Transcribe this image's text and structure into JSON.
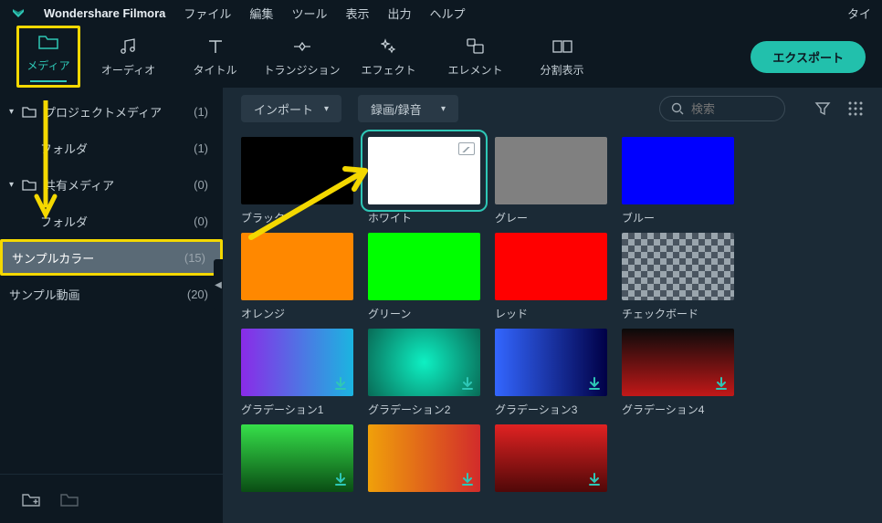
{
  "app_title": "Wondershare Filmora",
  "menu": [
    "ファイル",
    "編集",
    "ツール",
    "表示",
    "出力",
    "ヘルプ"
  ],
  "titlebar_right": "タイ",
  "tabs": [
    {
      "id": "media",
      "label": "メディア"
    },
    {
      "id": "audio",
      "label": "オーディオ"
    },
    {
      "id": "title",
      "label": "タイトル"
    },
    {
      "id": "transition",
      "label": "トランジション"
    },
    {
      "id": "effect",
      "label": "エフェクト"
    },
    {
      "id": "element",
      "label": "エレメント"
    },
    {
      "id": "split",
      "label": "分割表示"
    }
  ],
  "export_label": "エクスポート",
  "sidebar": {
    "items": [
      {
        "label": "プロジェクトメディア",
        "count": "(1)",
        "chevron": true,
        "folder": true
      },
      {
        "label": "フォルダ",
        "count": "(1)",
        "child": true
      },
      {
        "label": "共有メディア",
        "count": "(0)",
        "chevron": true,
        "folder": true
      },
      {
        "label": "フォルダ",
        "count": "(0)",
        "child": true
      },
      {
        "label": "サンプルカラー",
        "count": "(15)",
        "selected": true,
        "boxed": true
      },
      {
        "label": "サンプル動画",
        "count": "(20)"
      }
    ]
  },
  "topbar": {
    "import_label": "インポート",
    "record_label": "録画/録音",
    "search_placeholder": "検索"
  },
  "cards": [
    [
      {
        "label": "ブラック",
        "bg": "#000000"
      },
      {
        "label": "ホワイト",
        "bg": "#ffffff",
        "boxed": true,
        "selected": true,
        "placeholder": true
      },
      {
        "label": "グレー",
        "bg": "#808080"
      },
      {
        "label": "ブルー",
        "bg": "#0000ff"
      }
    ],
    [
      {
        "label": "オレンジ",
        "bg": "#ff8800"
      },
      {
        "label": "グリーン",
        "bg": "#00ff00"
      },
      {
        "label": "レッド",
        "bg": "#ff0000"
      },
      {
        "label": "チェックボード",
        "class": "checker"
      }
    ],
    [
      {
        "label": "グラデーション1",
        "class": "grad1",
        "dl": true
      },
      {
        "label": "グラデーション2",
        "class": "grad2",
        "dl": true
      },
      {
        "label": "グラデーション3",
        "class": "grad3",
        "dl": true
      },
      {
        "label": "グラデーション4",
        "class": "grad4",
        "dl": true
      }
    ],
    [
      {
        "label": "",
        "class": "grad5",
        "dl": true
      },
      {
        "label": "",
        "class": "grad6",
        "dl": true
      },
      {
        "label": "",
        "class": "grad7",
        "dl": true
      }
    ]
  ]
}
